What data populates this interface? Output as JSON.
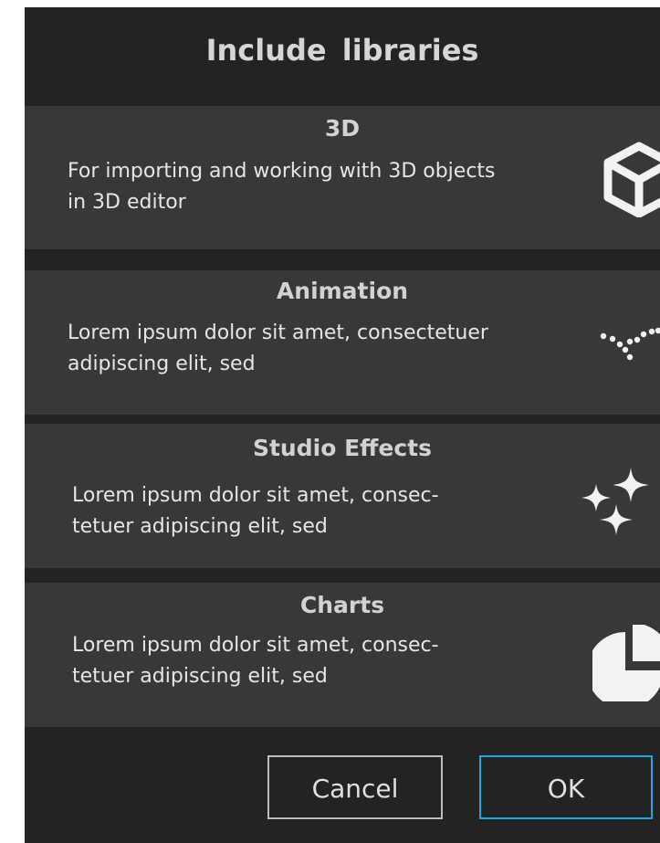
{
  "dialog": {
    "title": "Include  libraries"
  },
  "libraries": [
    {
      "title": "3D",
      "description": "For importing and working with 3D objects in 3D editor",
      "icon": "cube-icon"
    },
    {
      "title": "Animation",
      "description": "Lorem ipsum dolor sit amet, consectetuer adipiscing elit, sed",
      "icon": "motion-path-icon"
    },
    {
      "title": "Studio Effects",
      "description": "Lorem ipsum dolor sit amet, consec-tetuer adipiscing elit, sed",
      "icon": "sparkles-icon"
    },
    {
      "title": "Charts",
      "description": "Lorem ipsum dolor sit amet, consec-tetuer adipiscing elit, sed",
      "icon": "pie-chart-icon"
    }
  ],
  "buttons": {
    "cancel_label": "Cancel",
    "ok_label": "OK"
  },
  "colors": {
    "background": "#232323",
    "item_background": "#383838",
    "ok_border": "#1fa6e6",
    "cancel_border": "#bdbdbd"
  }
}
